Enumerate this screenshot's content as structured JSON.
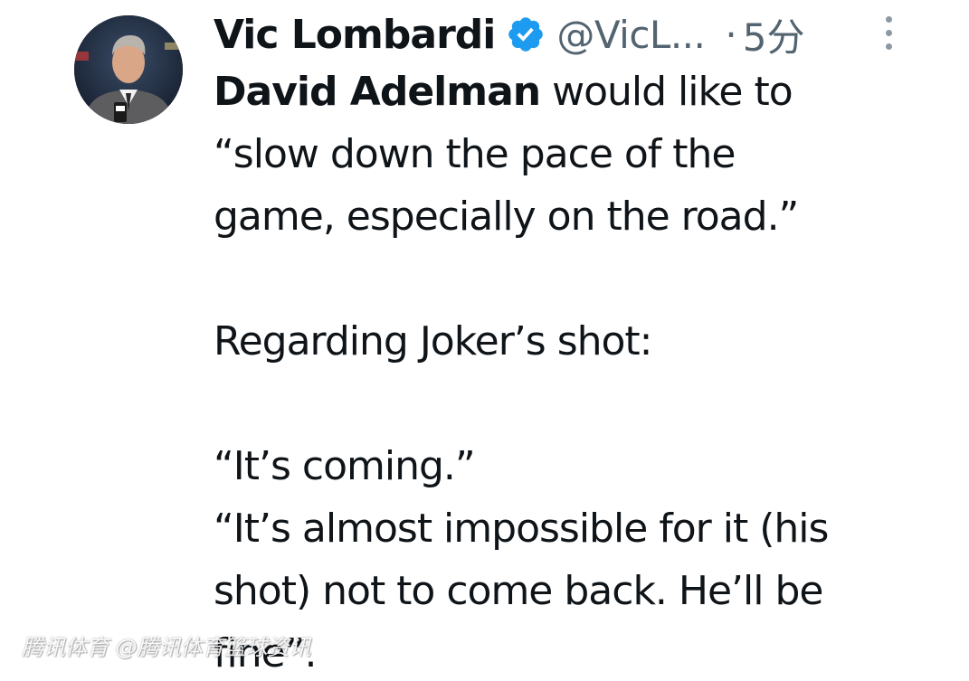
{
  "tweet": {
    "author": {
      "display_name": "Vic Lombardi",
      "handle": "@VicL...",
      "verified": true,
      "verified_icon": "verified-badge-icon",
      "verified_color": "#1d9bf0",
      "avatar_icon": "profile-photo"
    },
    "separator": "·",
    "timestamp": "5分",
    "more_icon": "vertical-ellipsis-icon",
    "body": {
      "line1_mention": "David Adelman",
      "line1_rest": " would like to",
      "line2": "“slow down the pace of the",
      "line3": "game, especially on the road.”",
      "line4": "Regarding Joker’s shot:",
      "line5": "“It’s coming.”",
      "line6": "“It’s almost impossible for it (his",
      "line7": "shot) not to come back.  He’ll be",
      "line8": "fine”."
    }
  },
  "watermark": {
    "text": "腾讯体育 @腾讯体育篮球资讯"
  }
}
